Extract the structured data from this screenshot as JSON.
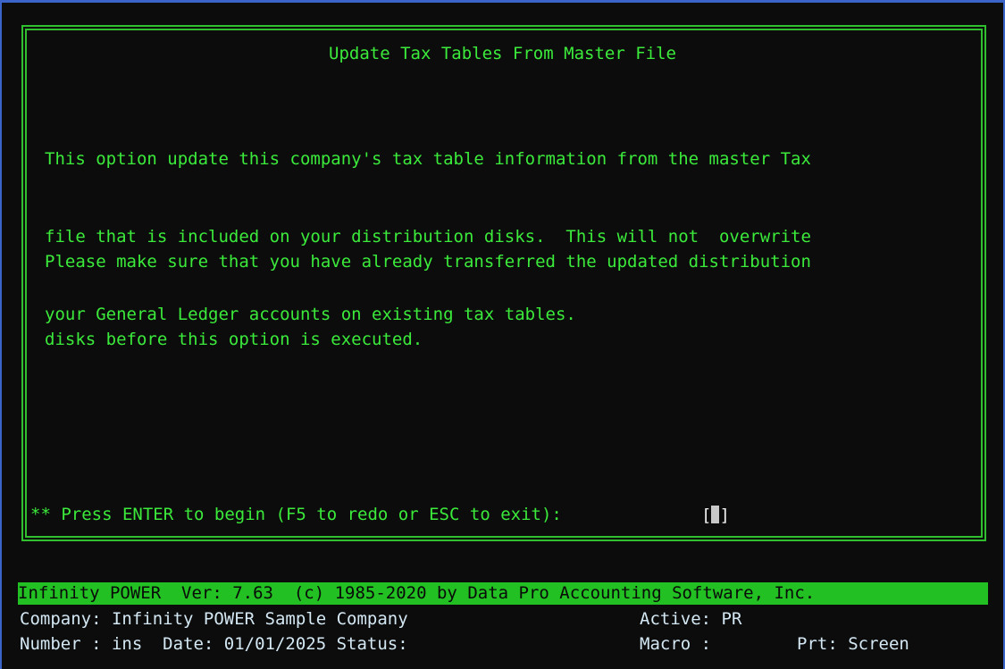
{
  "screen": {
    "title": "Update Tax Tables From Master File",
    "paragraph1": [
      "This option update this company's tax table information from the master Tax",
      "file that is included on your distribution disks.  This will not  overwrite",
      "your General Ledger accounts on existing tax tables."
    ],
    "paragraph2": [
      "Please make sure that you have already transferred the updated distribution",
      "disks before this option is executed."
    ],
    "prompt": "** Press ENTER to begin (F5 to redo or ESC to exit):",
    "input_open": "[",
    "input_close": "]"
  },
  "status_bar": {
    "text": "Infinity POWER  Ver: 7.63  (c) 1985-2020 by Data Pro Accounting Software, Inc."
  },
  "footer": {
    "company_line": "Company: Infinity POWER Sample Company",
    "number_line": "Number : ins  Date: 01/01/2025 Status:",
    "active": "Active: PR",
    "macro": "Macro :",
    "printer": "Prt: Screen"
  },
  "colors": {
    "foreground": "#3bea3b",
    "background": "#0c0c0c",
    "status_bar": "#22c022",
    "footer_text": "#d4e8f4"
  }
}
